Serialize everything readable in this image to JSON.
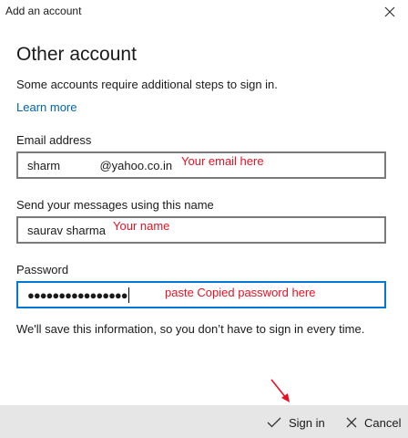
{
  "window": {
    "title": "Add an account",
    "close_label": "×"
  },
  "heading": "Other account",
  "description": "Some accounts require additional steps to sign in.",
  "learn_more": "Learn more",
  "email": {
    "label": "Email address",
    "value": "sharm            @yahoo.co.in",
    "annotation": "Your email here"
  },
  "name": {
    "label": "Send your messages using this name",
    "value": "saurav sharma",
    "annotation": "Your name"
  },
  "password": {
    "label": "Password",
    "masked": "●●●●●●●●●●●●●●●●",
    "annotation": "paste Copied password here"
  },
  "note": "We'll save this information, so you don’t have to sign in every time.",
  "footer": {
    "sign_in": "Sign in",
    "cancel": "Cancel"
  },
  "colors": {
    "accent": "#0078d7",
    "link": "#0063b1",
    "annotation": "#e81123",
    "footer_bg": "#e6e6e6"
  }
}
